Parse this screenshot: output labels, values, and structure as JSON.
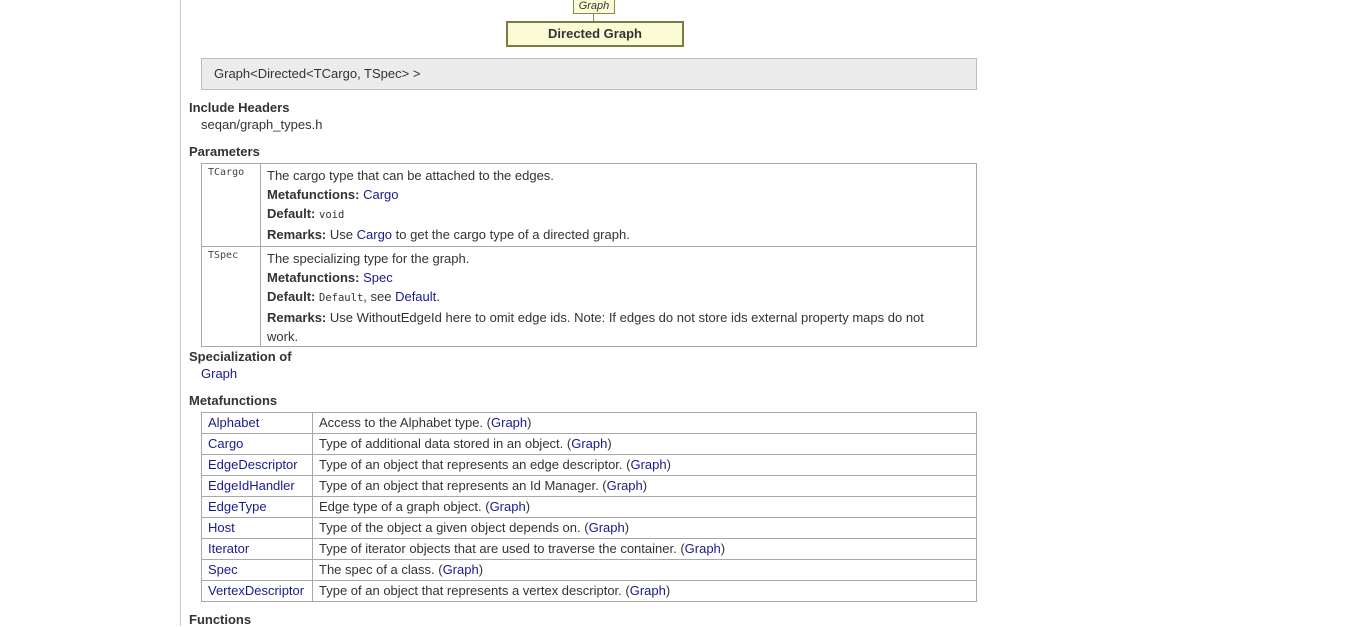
{
  "diagram": {
    "parent_label": "Graph",
    "node_label": "Directed Graph"
  },
  "signature": "Graph<Directed<TCargo, TSpec> >",
  "include_headers": {
    "heading": "Include Headers",
    "value": "seqan/graph_types.h"
  },
  "parameters": {
    "heading": "Parameters",
    "items": [
      {
        "name": "TCargo",
        "description": "The cargo type that can be attached to the edges.",
        "metafunctions_label": "Metafunctions:",
        "metafunctions_link": "Cargo",
        "default_label": "Default:",
        "default_code": "void",
        "remarks_label": "Remarks:",
        "remarks_pre": "Use ",
        "remarks_link": "Cargo",
        "remarks_post": " to get the cargo type of a directed graph."
      },
      {
        "name": "TSpec",
        "description": "The specializing type for the graph.",
        "metafunctions_label": "Metafunctions:",
        "metafunctions_link": "Spec",
        "default_label": "Default:",
        "default_code": "Default",
        "default_mid": ", see ",
        "default_link": "Default",
        "default_end": ".",
        "remarks_label": "Remarks:",
        "remarks_line1": "Use WithoutEdgeId here to omit edge ids. Note: If edges do not store ids external property maps do not",
        "remarks_line2": "work."
      }
    ]
  },
  "specialization_of": {
    "heading": "Specialization of",
    "link": "Graph"
  },
  "metafunctions": {
    "heading": "Metafunctions",
    "rows": [
      {
        "name": "Alphabet",
        "desc": "Access to the Alphabet type. (",
        "link": "Graph",
        "end": ")"
      },
      {
        "name": "Cargo",
        "desc": "Type of additional data stored in an object. (",
        "link": "Graph",
        "end": ")"
      },
      {
        "name": "EdgeDescriptor",
        "desc": "Type of an object that represents an edge descriptor. (",
        "link": "Graph",
        "end": ")"
      },
      {
        "name": "EdgeIdHandler",
        "desc": "Type of an object that represents an Id Manager. (",
        "link": "Graph",
        "end": ")"
      },
      {
        "name": "EdgeType",
        "desc": "Edge type of a graph object. (",
        "link": "Graph",
        "end": ")"
      },
      {
        "name": "Host",
        "desc": "Type of the object a given object depends on. (",
        "link": "Graph",
        "end": ")"
      },
      {
        "name": "Iterator",
        "desc": "Type of iterator objects that are used to traverse the container. (",
        "link": "Graph",
        "end": ")"
      },
      {
        "name": "Spec",
        "desc": "The spec of a class. (",
        "link": "Graph",
        "end": ")"
      },
      {
        "name": "VertexDescriptor",
        "desc": "Type of an object that represents a vertex descriptor. (",
        "link": "Graph",
        "end": ")"
      }
    ]
  },
  "functions": {
    "heading": "Functions"
  },
  "colors": {
    "link": "#1a1a8c",
    "diagram_fill": "#fbfbd5",
    "signature_bg": "#ececec"
  }
}
